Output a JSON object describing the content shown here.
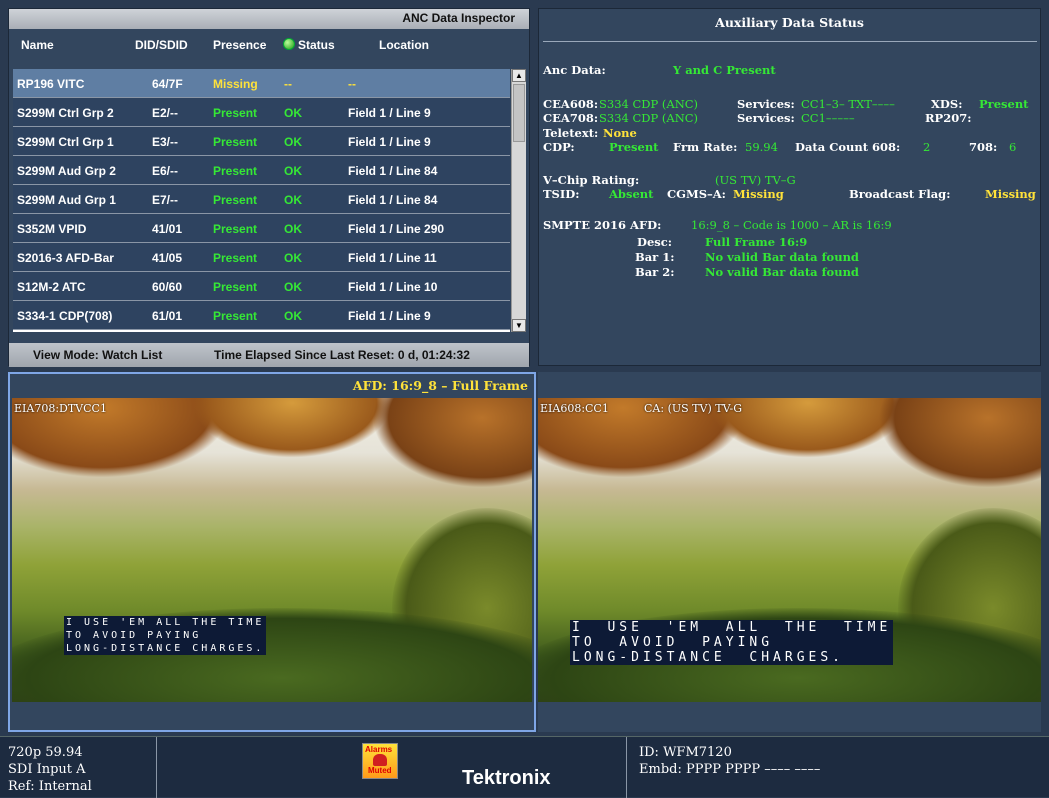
{
  "inspector": {
    "title": "ANC Data Inspector",
    "headers": {
      "name": "Name",
      "did": "DID/SDID",
      "presence": "Presence",
      "status": "Status",
      "location": "Location"
    },
    "rows": [
      {
        "name": "RP196 VITC",
        "did": "64/7F",
        "presence": "Missing",
        "status": "--",
        "location": "--",
        "selected": true
      },
      {
        "name": "S299M Ctrl Grp 2",
        "did": "E2/--",
        "presence": "Present",
        "status": "OK",
        "location": "Field 1 / Line 9"
      },
      {
        "name": "S299M Ctrl Grp 1",
        "did": "E3/--",
        "presence": "Present",
        "status": "OK",
        "location": "Field 1 / Line 9"
      },
      {
        "name": "S299M Aud Grp 2",
        "did": "E6/--",
        "presence": "Present",
        "status": "OK",
        "location": "Field 1 / Line 84"
      },
      {
        "name": "S299M Aud Grp 1",
        "did": "E7/--",
        "presence": "Present",
        "status": "OK",
        "location": "Field 1 / Line 84"
      },
      {
        "name": "S352M VPID",
        "did": "41/01",
        "presence": "Present",
        "status": "OK",
        "location": "Field 1 / Line 290"
      },
      {
        "name": "S2016-3 AFD-Bar",
        "did": "41/05",
        "presence": "Present",
        "status": "OK",
        "location": "Field 1 / Line 11"
      },
      {
        "name": "S12M-2 ATC",
        "did": "60/60",
        "presence": "Present",
        "status": "OK",
        "location": "Field 1 / Line 10"
      },
      {
        "name": "S334-1 CDP(708)",
        "did": "61/01",
        "presence": "Present",
        "status": "OK",
        "location": "Field 1 / Line 9"
      }
    ],
    "view_mode": "View Mode: Watch List",
    "elapsed": "Time Elapsed Since Last Reset: 0 d, 01:24:32"
  },
  "aux": {
    "title": "Auxiliary Data Status",
    "anc_label": "Anc Data:",
    "anc_value": "Y and C Present",
    "cea608_label": "CEA608:",
    "cea608_value": "S334 CDP (ANC)",
    "services_label": "Services:",
    "cea608_services": "CC1–3– TXT––––",
    "xds_label": "XDS:",
    "xds_value": "Present",
    "cea708_label": "CEA708:",
    "cea708_value": "S334 CDP (ANC)",
    "cea708_services": "CC1–––––",
    "rp207_label": "RP207:",
    "teletext_label": "Teletext:",
    "teletext_value": "None",
    "cdp_label": "CDP:",
    "cdp_value": "Present",
    "frm_label": "Frm Rate:",
    "frm_value": "59.94",
    "dc608_label": "Data Count 608:",
    "dc608_value": "2",
    "dc708_label": "708:",
    "dc708_value": "6",
    "vchip_label": "V–Chip Rating:",
    "vchip_value": "(US TV) TV–G",
    "tsid_label": "TSID:",
    "tsid_value": "Absent",
    "cgms_label": "CGMS–A:",
    "cgms_value": "Missing",
    "bflag_label": "Broadcast Flag:",
    "bflag_value": "Missing",
    "afd_label": "SMPTE 2016 AFD:",
    "afd_value": "16:9_8 – Code is 1000 – AR is 16:9",
    "desc_label": "Desc:",
    "desc_value": "Full Frame 16:9",
    "bar1_label": "Bar 1:",
    "bar1_value": "No valid Bar data found",
    "bar2_label": "Bar 2:",
    "bar2_value": "No valid Bar data found"
  },
  "video_left": {
    "afd": "AFD: 16:9_8 – Full Frame",
    "cc_id": "EIA708:DTVCC1",
    "caption": [
      "I USE 'EM ALL THE TIME",
      "TO AVOID PAYING",
      "LONG-DISTANCE CHARGES."
    ]
  },
  "video_right": {
    "cc_id": "EIA608:CC1",
    "ca": "CA: (US TV) TV-G",
    "caption": [
      "I  USE  'EM  ALL  THE  TIME",
      "TO  AVOID  PAYING",
      "LONG-DISTANCE  CHARGES."
    ]
  },
  "bottom": {
    "format": "720p 59.94",
    "input": "SDI Input A",
    "ref": "Ref: Internal",
    "alarm_top": "Alarms",
    "alarm_bottom": "Muted",
    "brand": "Tektronix",
    "id": "ID: WFM7120",
    "embd": "Embd: PPPP PPPP –––– ––––"
  }
}
